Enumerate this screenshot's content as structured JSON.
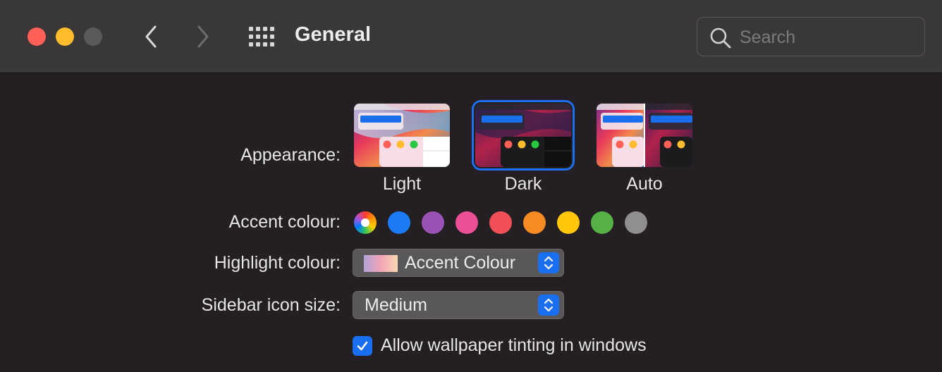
{
  "window": {
    "title": "General",
    "search_placeholder": "Search"
  },
  "toolbar": {
    "close_color": "#fe5f57",
    "minimize_color": "#febc2e",
    "zoom_color": "#5b595a",
    "back_icon": "chevron-left-icon",
    "forward_icon": "chevron-right-icon",
    "grid_icon": "grid-icon",
    "search_icon": "search-icon"
  },
  "appearance": {
    "label": "Appearance:",
    "options": [
      "Light",
      "Dark",
      "Auto"
    ],
    "selected": "Dark"
  },
  "accent": {
    "label": "Accent colour:",
    "colors": [
      "multicolor",
      "#1a7bf5",
      "#9b52b6",
      "#ec4f95",
      "#f14f57",
      "#f78b23",
      "#ffc60a",
      "#55b145",
      "#8f8f8f"
    ]
  },
  "highlight": {
    "label": "Highlight colour:",
    "value": "Accent Colour"
  },
  "sidebar_icon_size": {
    "label": "Sidebar icon size:",
    "value": "Medium"
  },
  "wallpaper_tinting": {
    "label": "Allow wallpaper tinting in windows",
    "checked": true
  }
}
